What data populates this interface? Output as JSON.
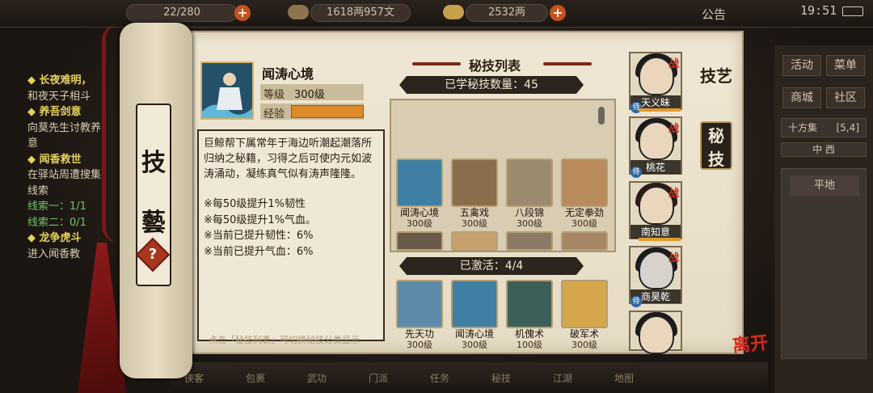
{
  "topbar": {
    "stamina": "22/280",
    "money": "1618两957文",
    "silver": "2532两",
    "notice_label": "公告",
    "time": "19:51"
  },
  "quests": [
    {
      "title": "长夜难明，",
      "lines": [
        "和夜天子相斗"
      ]
    },
    {
      "title": "养吾剑意",
      "lines": [
        "向莫先生讨教养",
        "意"
      ]
    },
    {
      "title": "闻香救世",
      "lines": [
        "在驿站周遭搜集"
      ],
      "extra": [
        "线索"
      ],
      "clues": [
        "线索一：1/1",
        "线索二：0/1"
      ]
    },
    {
      "title": "龙争虎斗",
      "lines": [
        "进入闻香教"
      ]
    }
  ],
  "right_menu": {
    "buttons": [
      "活动",
      "菜单",
      "商城",
      "社区"
    ],
    "area": "十方集",
    "area_coord": "[5,4]",
    "compass": "中 西",
    "terrain": "平地"
  },
  "bottom_menu": [
    "侠客",
    "包裹",
    "武功",
    "门派",
    "任务",
    "秘技",
    "江湖",
    "地图"
  ],
  "scroll": {
    "chars": [
      "技",
      "藝"
    ],
    "help": "?"
  },
  "skill_detail": {
    "name": "闻涛心境",
    "level_label": "等级",
    "level_value": "300级",
    "exp_label": "经验",
    "exp_fraction": 1.0,
    "description": "巨鲸帮下属常年于海边听潮起潮落所归纳之秘籍，习得之后可使内元如波涛涌动，凝练真气似有涛声隆隆。",
    "bonuses": [
      "※每50级提升1%韧性",
      "※每50级提升1%气血。",
      "※当前已提升韧性：6%",
      "※当前已提升气血：6%"
    ],
    "hint": "点击「秘技列表」可切换秘技分类显示"
  },
  "secret_list": {
    "title": "秘技列表",
    "learned_label": "已学秘技数量：45",
    "learned": [
      {
        "name": "闻涛心境",
        "level": "300级",
        "color": "#3e7fa3"
      },
      {
        "name": "五禽戏",
        "level": "300级",
        "color": "#8a6d4c"
      },
      {
        "name": "八段锦",
        "level": "300级",
        "color": "#9a8a70"
      },
      {
        "name": "无定拳劲",
        "level": "300级",
        "color": "#b98a5c"
      }
    ],
    "partial_row_colors": [
      "#6a5a4a",
      "#c8a070",
      "#8a7a66",
      "#a68664"
    ],
    "activated_label": "已激活：4/4",
    "activated": [
      {
        "name": "先天功",
        "level": "300级",
        "color": "#5c8aa8"
      },
      {
        "name": "闻涛心境",
        "level": "300级",
        "color": "#3e7fa3"
      },
      {
        "name": "机傀术",
        "level": "100级",
        "color": "#3c5f5a"
      },
      {
        "name": "破军术",
        "level": "300级",
        "color": "#d6a64a"
      }
    ]
  },
  "characters": [
    {
      "name": "天义昧",
      "tag": "战"
    },
    {
      "name": "桃花",
      "tag": "战"
    },
    {
      "name": "南知意",
      "tag": "战"
    },
    {
      "name": "商昊乾",
      "tag": "战"
    },
    {
      "name": "",
      "tag": ""
    }
  ],
  "tabs": {
    "skills": "技艺",
    "secret": "秘技"
  },
  "leave_label": "离开"
}
